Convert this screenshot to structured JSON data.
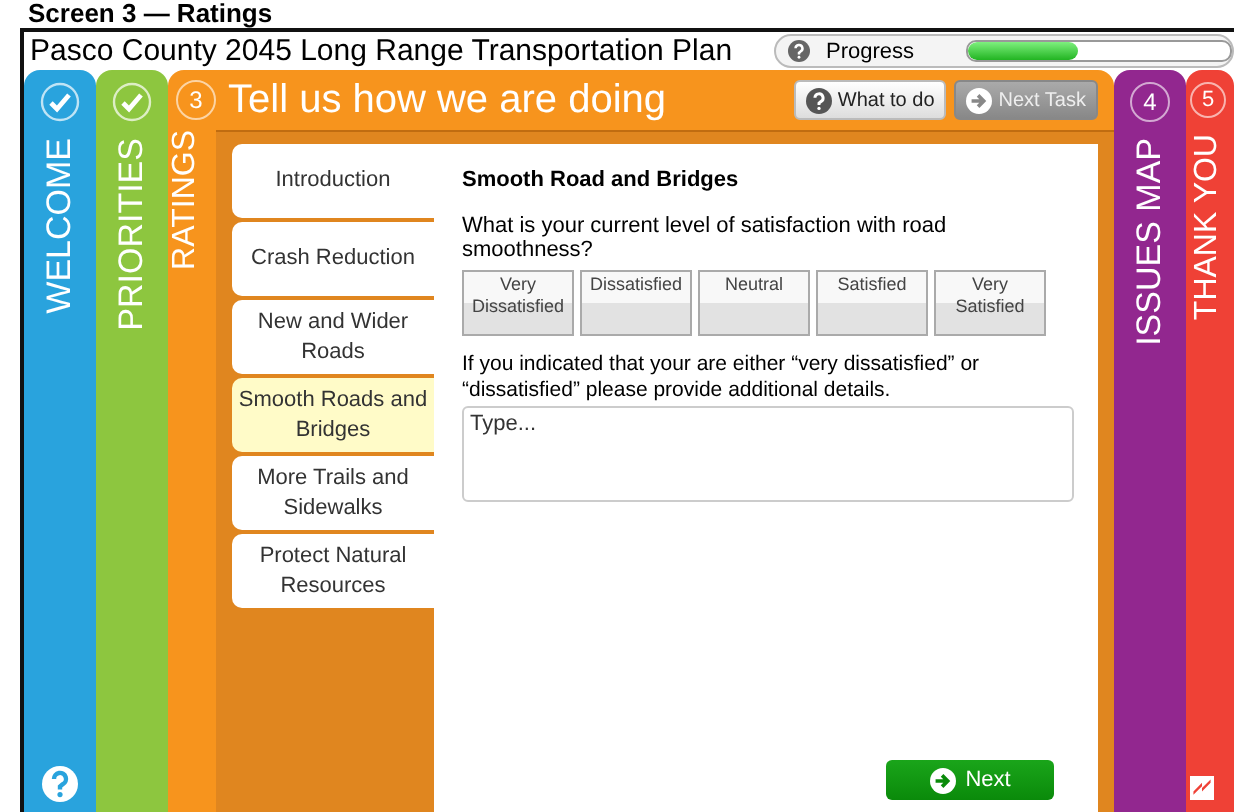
{
  "caption": "Screen 3 — Ratings",
  "window": {
    "title": "Pasco County 2045 Long Range Transportation Plan"
  },
  "progress": {
    "label": "Progress",
    "level": 0.42
  },
  "steps": [
    {
      "kind": "done",
      "label": "WELCOME",
      "color": "#29a3dd"
    },
    {
      "kind": "done",
      "label": "PRIORITIES",
      "color": "#8dc63f"
    },
    {
      "kind": "current",
      "number": "3",
      "label": "RATINGS",
      "color": "#f7941d"
    },
    {
      "kind": "upcoming",
      "number": "4",
      "label": "ISSUES MAP",
      "color": "#92278f"
    },
    {
      "kind": "upcoming",
      "number": "5",
      "label": "THANK YOU",
      "color": "#ef4136"
    }
  ],
  "header": {
    "title": "Tell us how we are doing",
    "buttons": [
      {
        "kind": "help",
        "label": "What to do",
        "disabled": false
      },
      {
        "kind": "next",
        "label": "Next Task",
        "disabled": true
      }
    ]
  },
  "topics": [
    {
      "label": "Introduction",
      "selected": false
    },
    {
      "label": "Crash Reduction",
      "selected": false
    },
    {
      "label": "New and Wider Roads",
      "selected": false
    },
    {
      "label": "Smooth Roads and Bridges",
      "selected": true
    },
    {
      "label": "More Trails and Sidewalks",
      "selected": false
    },
    {
      "label": "Protect Natural Resources",
      "selected": false
    }
  ],
  "question": {
    "heading": "Smooth Road and Bridges",
    "prompt": "What is your current level of satisfaction with road smoothness?",
    "options": [
      {
        "label": "Very Dissatisfied",
        "selected": false
      },
      {
        "label": "Dissatisfied",
        "selected": false
      },
      {
        "label": "Neutral",
        "selected": false
      },
      {
        "label": "Satisfied",
        "selected": false
      },
      {
        "label": "Very Satisfied",
        "selected": false
      }
    ],
    "details_prompt": "If you indicated that your are either “very dissatisfied” or “dissatisfied” please provide additional details.",
    "placeholder": "Type..."
  },
  "next_button": "Next"
}
